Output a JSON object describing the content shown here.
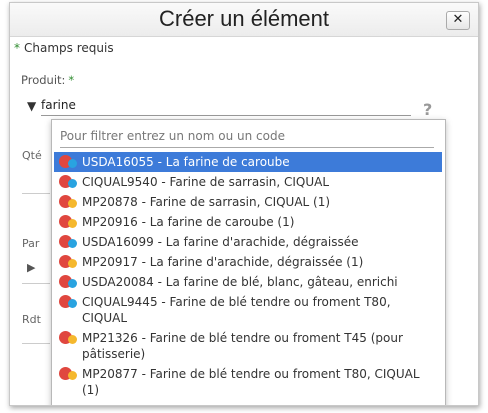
{
  "dialog": {
    "title": "Créer un élément",
    "close_label": "✕",
    "required_note": "Champs requis",
    "required_star": "*"
  },
  "form": {
    "product_label": "Produit:",
    "product_star": "*",
    "product_value": "farine",
    "help": "?",
    "qty_label": "Qté",
    "part_label": "Par",
    "rdt_label": "Rdt"
  },
  "dropdown": {
    "filter_placeholder": "Pour filtrer entrez un nom ou un code",
    "options": [
      {
        "text": "USDA16055 - La farine de caroube",
        "dot": "#29a3e0"
      },
      {
        "text": "CIQUAL9540 - Farine de sarrasin, CIQUAL",
        "dot": "#29a3e0"
      },
      {
        "text": "MP20878 - Farine de sarrasin, CIQUAL (1)",
        "dot": "#f5b82e"
      },
      {
        "text": "MP20916 - La farine de caroube (1)",
        "dot": "#f5b82e"
      },
      {
        "text": "USDA16099 - La farine d'arachide, dégraissée",
        "dot": "#29a3e0"
      },
      {
        "text": "MP20917 - La farine d'arachide, dégraissée (1)",
        "dot": "#f5b82e"
      },
      {
        "text": "USDA20084 - La farine de blé, blanc, gâteau, enrichi",
        "dot": "#29a3e0"
      },
      {
        "text": "CIQUAL9445 - Farine de blé tendre ou froment T80, CIQUAL",
        "dot": "#29a3e0"
      },
      {
        "text": "MP21326 - Farine de blé tendre ou froment T45 (pour pâtisserie)",
        "dot": "#f5b82e"
      },
      {
        "text": "MP20877 - Farine de blé tendre ou froment T80, CIQUAL (1)",
        "dot": "#f5b82e"
      }
    ]
  },
  "colors": {
    "selected": "#3d7bd9",
    "badge_red": "#e0473f",
    "required": "#2e8b2e"
  },
  "icons": {
    "product_caret": "caret-down-icon",
    "close": "close-icon",
    "help": "help-icon",
    "expand": "play-icon",
    "option_badge": "product-badge-icon"
  }
}
